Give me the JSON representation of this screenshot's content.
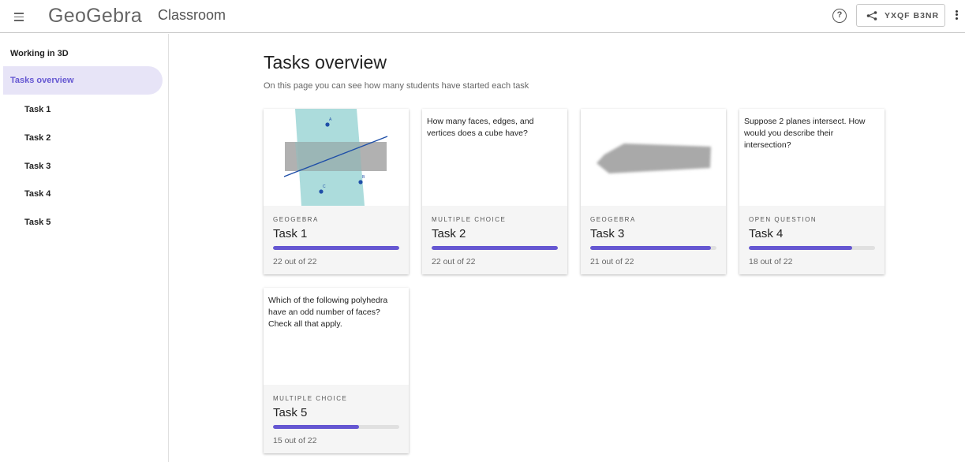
{
  "header": {
    "logo": "GeoGebra",
    "app_name": "Classroom",
    "share_code": "YXQF B3NR"
  },
  "sidebar": {
    "items": [
      {
        "label": "Working in 3D",
        "active": false
      },
      {
        "label": "Tasks overview",
        "active": true
      },
      {
        "label": "Task 1",
        "active": false
      },
      {
        "label": "Task 2",
        "active": false
      },
      {
        "label": "Task 3",
        "active": false
      },
      {
        "label": "Task 4",
        "active": false
      },
      {
        "label": "Task 5",
        "active": false
      }
    ]
  },
  "main": {
    "title": "Tasks overview",
    "subtitle": "On this page you can see how many students have started each task",
    "tasks": [
      {
        "type": "GEOGEBRA",
        "name": "Task 1",
        "count": "22 out of 22",
        "progress": 1.0,
        "question": "",
        "preview_labels": [
          "A",
          "B",
          "C"
        ]
      },
      {
        "type": "MULTIPLE CHOICE",
        "name": "Task 2",
        "count": "22 out of 22",
        "progress": 1.0,
        "question": "How many faces, edges, and vertices does a cube have?"
      },
      {
        "type": "GEOGEBRA",
        "name": "Task 3",
        "count": "21 out of 22",
        "progress": 0.955,
        "question": ""
      },
      {
        "type": "OPEN QUESTION",
        "name": "Task 4",
        "count": "18 out of 22",
        "progress": 0.818,
        "question": "Suppose 2 planes intersect. How would you describe their intersection?"
      },
      {
        "type": "MULTIPLE CHOICE",
        "name": "Task 5",
        "count": "15 out of 22",
        "progress": 0.682,
        "question": "Which of the following polyhedra have an odd number of faces? Check all that apply."
      }
    ]
  },
  "colors": {
    "accent": "#6557d2",
    "active_bg": "#e7e4f7",
    "plane_teal": "#9ed6d6",
    "plane_gray": "#a9a9a9",
    "line_blue": "#1f4fa8"
  },
  "icons": {
    "menu": "hamburger-menu-icon",
    "help": "help-circle-icon",
    "share": "share-icon",
    "more": "more-vertical-icon"
  }
}
